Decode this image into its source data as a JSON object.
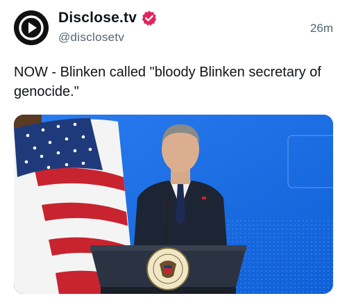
{
  "header": {
    "display_name": "Disclose.tv",
    "handle": "@disclosetv",
    "timestamp": "26m",
    "verified_badge_color": "#e0245e",
    "avatar_icon": "play-logo-icon"
  },
  "tweet": {
    "text": "NOW - Blinken called \"bloody Blinken secretary of genocide.\""
  },
  "media": {
    "description_icon": "photo-media",
    "podium_seal_text": "DEPARTMENT OF STATE · UNITED STATES OF AMERICA"
  },
  "colors": {
    "background": "#ffffff",
    "text": "#0f1419",
    "muted": "#536471",
    "backdrop_blue": "#1e6fe0"
  }
}
